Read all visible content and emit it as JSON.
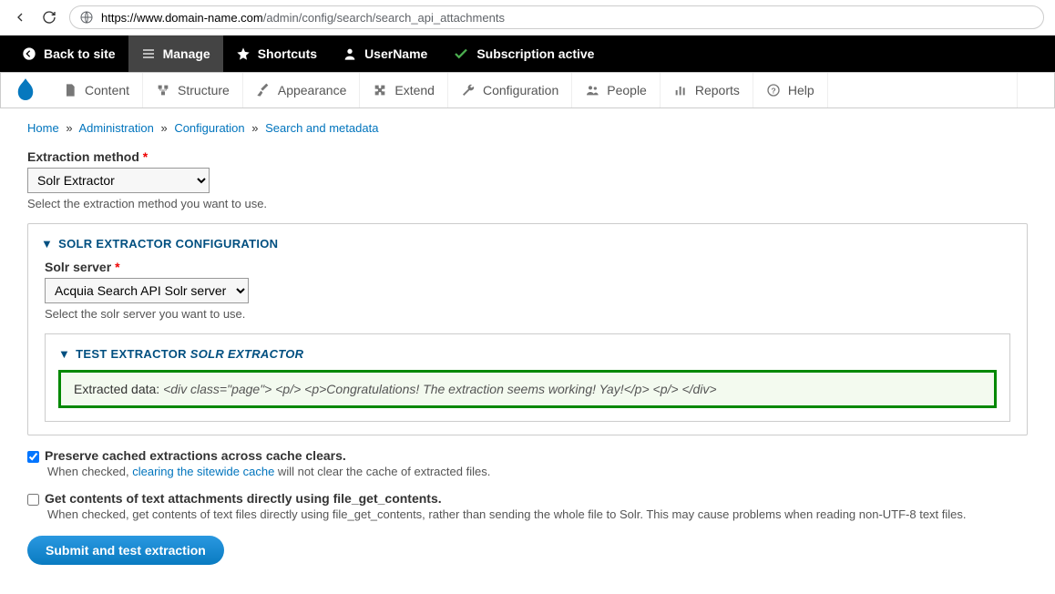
{
  "browser": {
    "url_prefix": "https://www.domain-name.com",
    "url_path": "/admin/config/search/search_api_attachments"
  },
  "toolbar": {
    "back_to_site": "Back to site",
    "manage": "Manage",
    "shortcuts": "Shortcuts",
    "username": "UserName",
    "subscription": "Subscription active"
  },
  "admin_menu": {
    "content": "Content",
    "structure": "Structure",
    "appearance": "Appearance",
    "extend": "Extend",
    "configuration": "Configuration",
    "people": "People",
    "reports": "Reports",
    "help": "Help"
  },
  "breadcrumb": {
    "home": "Home",
    "administration": "Administration",
    "configuration": "Configuration",
    "search": "Search and metadata"
  },
  "form": {
    "extraction_method_label": "Extraction method",
    "extraction_method_value": "Solr Extractor",
    "extraction_method_desc": "Select the extraction method you want to use.",
    "solr_config_legend": "SOLR EXTRACTOR CONFIGURATION",
    "solr_server_label": "Solr server",
    "solr_server_value": "Acquia Search API Solr server",
    "solr_server_desc": "Select the solr server you want to use.",
    "test_legend_a": "TEST EXTRACTOR ",
    "test_legend_b": "SOLR EXTRACTOR",
    "status_label": "Extracted data: ",
    "status_markup": "<div class=\"page\"> <p/> <p>Congratulations! The extraction seems working! Yay!</p> <p/> </div>",
    "preserve_label": "Preserve cached extractions across cache clears.",
    "preserve_desc_a": "When checked, ",
    "preserve_desc_link": "clearing the sitewide cache",
    "preserve_desc_b": " will not clear the cache of extracted files.",
    "getcontents_label": "Get contents of text attachments directly using file_get_contents.",
    "getcontents_desc": "When checked, get contents of text files directly using file_get_contents, rather than sending the whole file to Solr. This may cause problems when reading non-UTF-8 text files.",
    "submit": "Submit and test extraction"
  }
}
